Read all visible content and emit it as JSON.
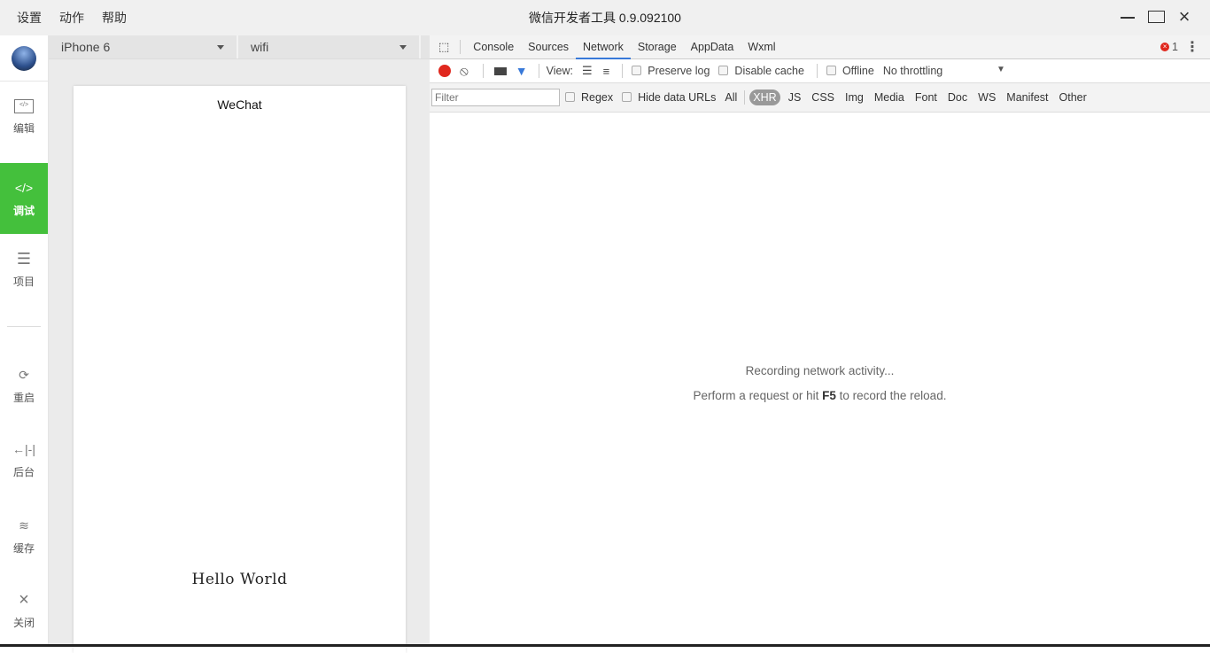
{
  "titlebar": {
    "menu": [
      "设置",
      "动作",
      "帮助"
    ],
    "title": "微信开发者工具 0.9.092100"
  },
  "sidebar": {
    "items": [
      {
        "label": "编辑",
        "icon": "code-box-icon"
      },
      {
        "label": "调试",
        "icon": "code-icon",
        "active": true
      },
      {
        "label": "项目",
        "icon": "menu-icon"
      },
      {
        "label": "重启",
        "icon": "restart-icon"
      },
      {
        "label": "后台",
        "icon": "background-icon"
      },
      {
        "label": "缓存",
        "icon": "layers-icon"
      },
      {
        "label": "关闭",
        "icon": "close-icon"
      }
    ]
  },
  "simulator": {
    "device": "iPhone 6",
    "network": "wifi",
    "nav_title": "WeChat",
    "content": "Hello World"
  },
  "devtools": {
    "tabs": [
      "Console",
      "Sources",
      "Network",
      "Storage",
      "AppData",
      "Wxml"
    ],
    "active_tab": "Network",
    "error_count": "1",
    "toolbar": {
      "view_label": "View:",
      "preserve_log": "Preserve log",
      "disable_cache": "Disable cache",
      "offline": "Offline",
      "throttling": "No throttling"
    },
    "filter": {
      "placeholder": "Filter",
      "regex": "Regex",
      "hide_data_urls": "Hide data URLs",
      "types": [
        "All",
        "XHR",
        "JS",
        "CSS",
        "Img",
        "Media",
        "Font",
        "Doc",
        "WS",
        "Manifest",
        "Other"
      ],
      "active_type": "XHR"
    },
    "message": {
      "line1": "Recording network activity...",
      "line2_pre": "Perform a request or hit ",
      "line2_key": "F5",
      "line2_post": " to record the reload."
    },
    "colors": {
      "record": "#e0281e",
      "accent": "#3879d9",
      "active_sidebar": "#44c03c"
    }
  }
}
